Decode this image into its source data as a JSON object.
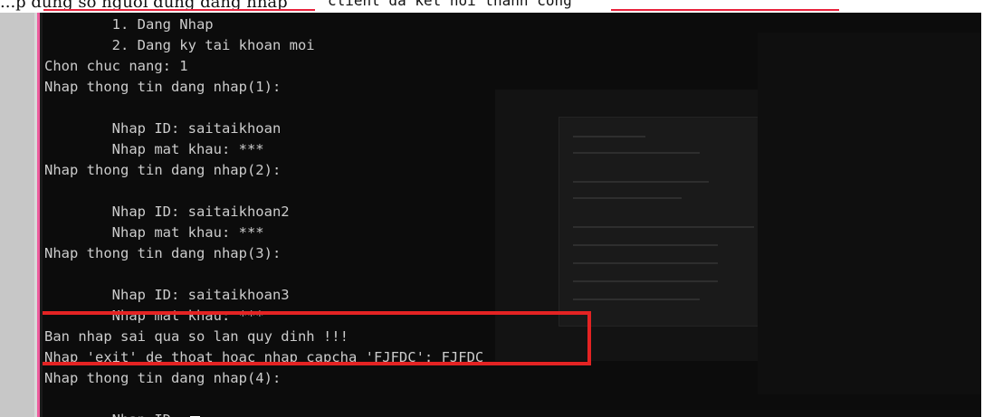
{
  "header": {
    "cut_left": "...p dung so nguoi dung dang nhap",
    "cut_mid": "client da ket noi thanh cong"
  },
  "console": {
    "lines": [
      "        1. Dang Nhap",
      "        2. Dang ky tai khoan moi",
      "Chon chuc nang: 1",
      "Nhap thong tin dang nhap(1):",
      "",
      "        Nhap ID: saitaikhoan",
      "        Nhap mat khau: ***",
      "Nhap thong tin dang nhap(2):",
      "",
      "        Nhap ID: saitaikhoan2",
      "        Nhap mat khau: ***",
      "Nhap thong tin dang nhap(3):",
      "",
      "        Nhap ID: saitaikhoan3",
      "        Nhap mat khau: ***",
      "Ban nhap sai qua so lan quy dinh !!!",
      "Nhap 'exit' de thoat hoac nhap capcha 'FJFDC': FJFDC",
      "Nhap thong tin dang nhap(4):",
      "",
      "        Nhap ID: "
    ]
  },
  "colors": {
    "console_bg": "#0c0c0c",
    "console_text": "#cccccc",
    "highlight": "#e42323"
  }
}
